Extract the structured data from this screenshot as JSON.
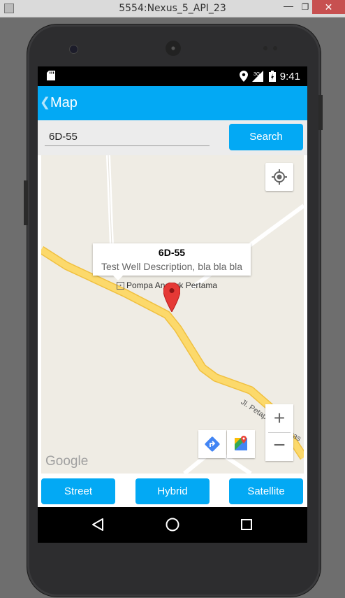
{
  "window": {
    "title": "5554:Nexus_5_API_23",
    "minimize_glyph": "—",
    "maximize_glyph": "❐",
    "close_glyph": "✕"
  },
  "status_bar": {
    "time": "9:41",
    "network_label": "3G",
    "icons": [
      "sd-card-icon",
      "location-icon",
      "signal-icon",
      "battery-icon"
    ]
  },
  "app_bar": {
    "title": "Map",
    "back_glyph": "❮"
  },
  "search": {
    "value": "6D-55",
    "button_label": "Search"
  },
  "map": {
    "marker": {
      "title": "6D-55",
      "description": "Test Well Description, bla bla bla"
    },
    "poi_label": "Pompa Angguk Pertama",
    "road_label": "Jl. Petapahan-Minas",
    "zoom_in": "+",
    "zoom_out": "−",
    "attribution": "Google",
    "icons": [
      "my-location-icon",
      "directions-icon",
      "google-maps-icon"
    ]
  },
  "map_types": {
    "street": "Street",
    "hybrid": "Hybrid",
    "satellite": "Satellite"
  },
  "nav_bar": {
    "icons": [
      "back-triangle-icon",
      "home-circle-icon",
      "recents-square-icon"
    ]
  },
  "colors": {
    "accent": "#03a9f4",
    "road": "#fcd96b",
    "map_background": "#efece4",
    "marker": "#e53935"
  }
}
